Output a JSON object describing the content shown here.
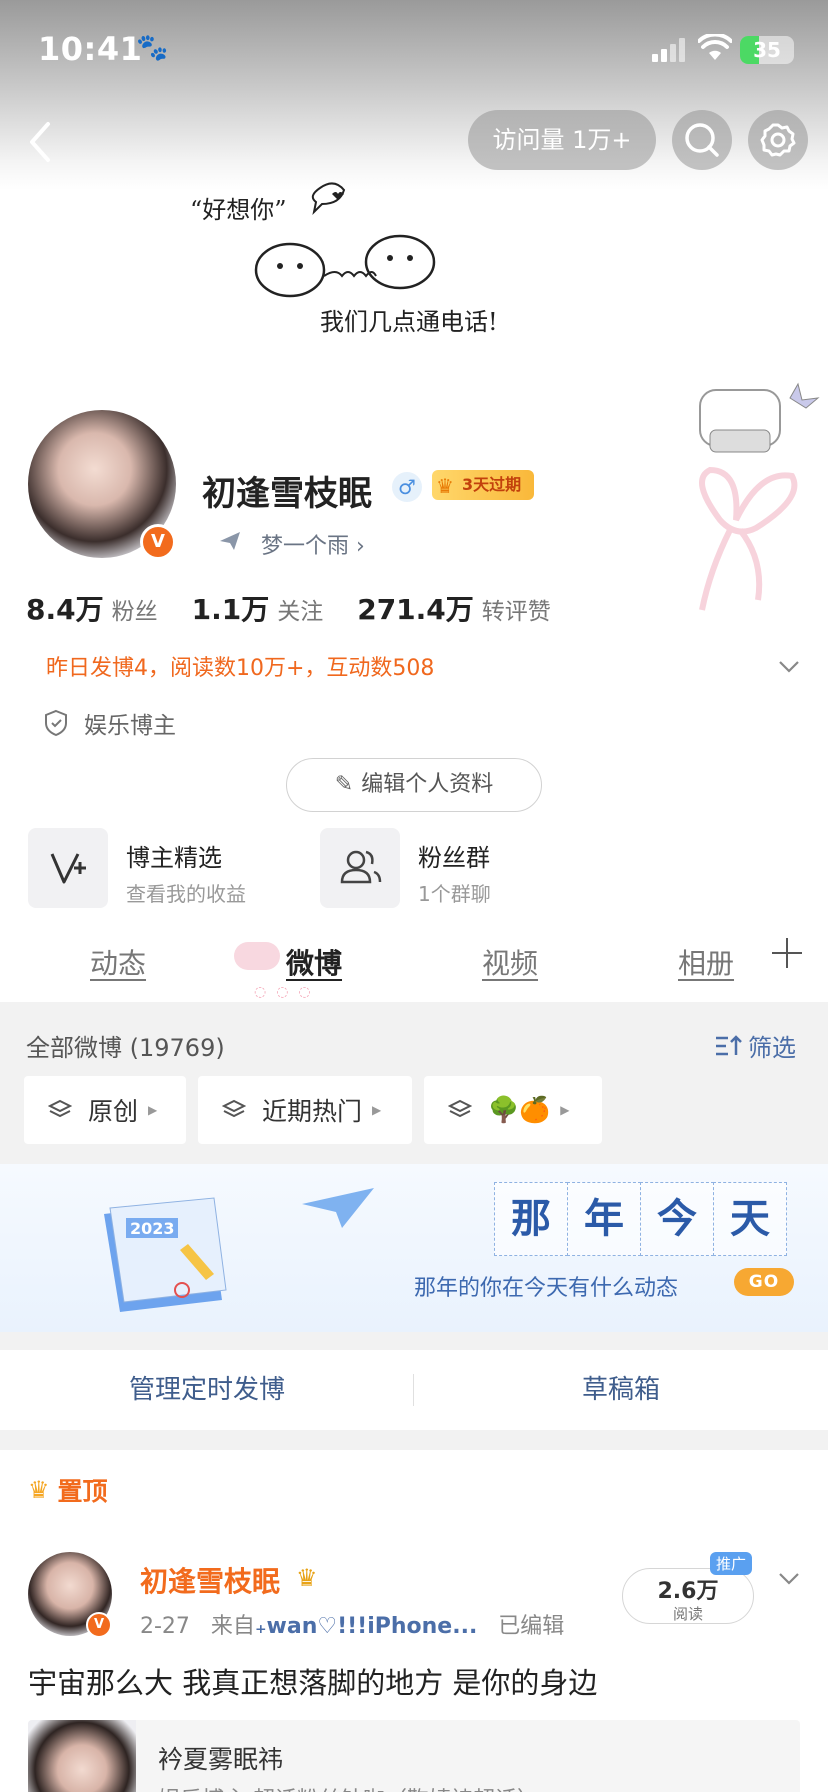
{
  "status_bar": {
    "time": "10:41",
    "battery": "35",
    "battery_level": 0.35
  },
  "header": {
    "visits_label": "访问量 1万+"
  },
  "cover": {
    "caption_top": "“好想你”",
    "caption_bottom": "我们几点通电话!"
  },
  "profile": {
    "name": "初逢雪枝眠",
    "gender_symbol": "♂",
    "vip_badge": "3天过期",
    "verified_mark": "V",
    "subtitle": "梦一个雨 ›",
    "stats": [
      {
        "num": "8.4万",
        "label": "粉丝"
      },
      {
        "num": "1.1万",
        "label": "关注"
      },
      {
        "num": "271.4万",
        "label": "转评赞"
      }
    ],
    "activity": "昨日发博4，阅读数10万+，互动数508",
    "category": "娱乐博主",
    "edit_button": "编辑个人资料"
  },
  "features": [
    {
      "title": "博主精选",
      "subtitle": "查看我的收益",
      "icon": "v-plus-icon"
    },
    {
      "title": "粉丝群",
      "subtitle": "1个群聊",
      "icon": "group-icon"
    }
  ],
  "tabs": [
    {
      "label": "动态"
    },
    {
      "label": "微博",
      "active": true
    },
    {
      "label": "视频"
    },
    {
      "label": "相册"
    }
  ],
  "feed": {
    "all_label": "全部微博 (19769)",
    "filter_label": "筛选",
    "chips": [
      {
        "label": "原创"
      },
      {
        "label": "近期热门"
      },
      {
        "label": "🌳🍊"
      }
    ],
    "banner": {
      "title_chars": [
        "那",
        "年",
        "今",
        "天"
      ],
      "subtitle": "那年的你在今天有什么动态",
      "go": "GO",
      "calendar_year": "2023"
    },
    "actions": [
      {
        "label": "管理定时发博"
      },
      {
        "label": "草稿箱"
      }
    ]
  },
  "post": {
    "pinned_label": "置顶",
    "author": "初逢雪枝眠",
    "meta_date": "2-27",
    "meta_from": "来自",
    "meta_source": "₊wan♡!!!iPhone...",
    "meta_edited": "已编辑",
    "reads_num": "2.6万",
    "reads_label": "阅读",
    "promo": "推广",
    "text": "宇宙那么大 我真正想落脚的地方 是你的身边",
    "quote_name": "衿夏雾眠祎",
    "quote_desc": "娱乐博主 超话粉丝钻咖（鞠婧祎超话）"
  },
  "colors": {
    "accent_orange": "#f26b1d",
    "link_blue": "#4b6ea8",
    "go_yellow": "#f7a832"
  }
}
